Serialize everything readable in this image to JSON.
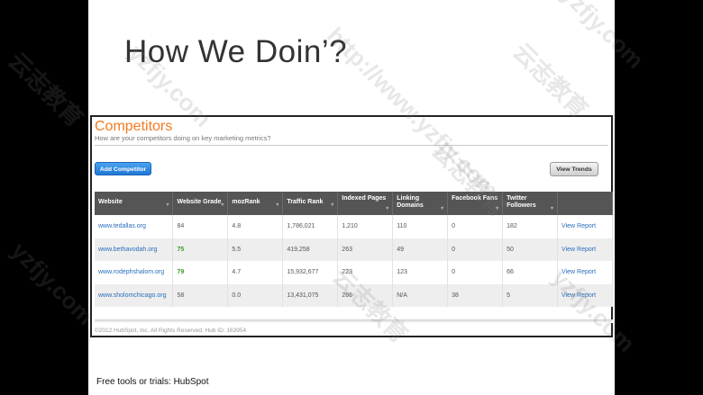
{
  "slide": {
    "title": "How We Doin’?",
    "source_note": "Free tools or trials: HubSpot"
  },
  "panel": {
    "title": "Competitors",
    "subtitle": "How are your competitors doing on key marketing metrics?",
    "add_button": "Add Competitor",
    "view_button": "View Trends",
    "footer": "©2012 HubSpot, Inc. All Rights Reserved. Hub ID: 163954",
    "columns": [
      "Website",
      "Website Grade",
      "mozRank",
      "Traffic Rank",
      "Indexed Pages",
      "Linking Domains",
      "Facebook Fans",
      "Twitter Followers",
      ""
    ],
    "rows": [
      {
        "site": "www.tedallas.org",
        "grade": "84",
        "moz": "4.8",
        "traffic": "1,786,021",
        "pages": "1,210",
        "domains": "110",
        "fans": "0",
        "followers": "182",
        "action": "View Report"
      },
      {
        "site": "www.bethavodah.org",
        "grade": "75",
        "moz": "5.5",
        "traffic": "419,258",
        "pages": "263",
        "domains": "49",
        "fans": "0",
        "followers": "50",
        "action": "View Report"
      },
      {
        "site": "www.rodephshalom.org",
        "grade": "79",
        "moz": "4.7",
        "traffic": "15,932,677",
        "pages": "223",
        "domains": "123",
        "fans": "0",
        "followers": "66",
        "action": "View Report"
      },
      {
        "site": "www.sholomchicago.org",
        "grade": "58",
        "moz": "0.0",
        "traffic": "13,431,075",
        "pages": "286",
        "domains": "N/A",
        "fans": "38",
        "followers": "5",
        "action": "View Report"
      }
    ]
  },
  "watermarks": [
    "http://www.yzfjy.com",
    "云志教育",
    "yzfjy.com"
  ],
  "colors": {
    "accent_orange": "#f47a20",
    "button_blue": "#1f77d6",
    "header_gray": "#555555",
    "link_blue": "#2a6ebb",
    "grade_green": "#3a9c2a"
  }
}
